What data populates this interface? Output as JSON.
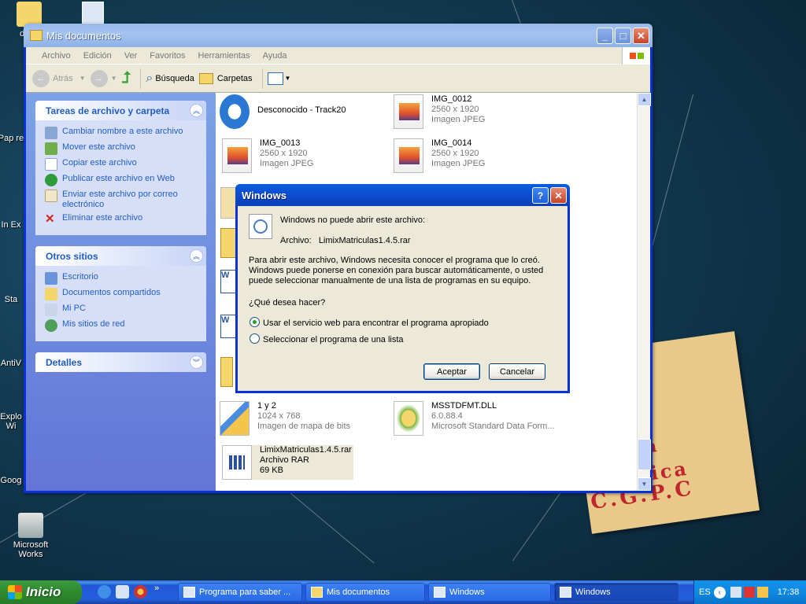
{
  "desktop": {
    "icons": [
      {
        "label": "docu"
      },
      {
        "label": "Pap re"
      },
      {
        "label": "In Ex"
      },
      {
        "label": "Sta"
      },
      {
        "label": "AntiV"
      },
      {
        "label": "Explo Wi"
      },
      {
        "label": "Goog"
      },
      {
        "label": "Microsoft Works"
      }
    ],
    "note_lines": [
      "a",
      "sica",
      "C.G.P.C"
    ]
  },
  "explorer": {
    "title": "Mis documentos",
    "menu": [
      "Archivo",
      "Edición",
      "Ver",
      "Favoritos",
      "Herramientas",
      "Ayuda"
    ],
    "toolbar": {
      "back": "Atrás",
      "search": "Búsqueda",
      "folders": "Carpetas"
    },
    "panels": {
      "tasks": {
        "title": "Tareas de archivo y carpeta",
        "items": [
          "Cambiar nombre a este archivo",
          "Mover este archivo",
          "Copiar este archivo",
          "Publicar este archivo en Web",
          "Enviar este archivo por correo electrónico",
          "Eliminar este archivo"
        ]
      },
      "other": {
        "title": "Otros sitios",
        "items": [
          "Escritorio",
          "Documentos compartidos",
          "Mi PC",
          "Mis sitios de red"
        ]
      },
      "details": {
        "title": "Detalles"
      }
    },
    "files": [
      {
        "name": "Desconocido - Track20",
        "l2": "",
        "l3": ""
      },
      {
        "name": "IMG_0012",
        "l2": "2560 x 1920",
        "l3": "Imagen JPEG"
      },
      {
        "name": "IMG_0013",
        "l2": "2560 x 1920",
        "l3": "Imagen JPEG"
      },
      {
        "name": "IMG_0014",
        "l2": "2560 x 1920",
        "l3": "Imagen JPEG"
      },
      {
        "name": "1 y 2",
        "l2": "1024 x 768",
        "l3": "Imagen de mapa de bits"
      },
      {
        "name": "MSSTDFMT.DLL",
        "l2": "6.0.88.4",
        "l3": "Microsoft Standard Data Form..."
      },
      {
        "name": "LimixMatriculas1.4.5.rar",
        "l2": "Archivo RAR",
        "l3": "69 KB"
      }
    ]
  },
  "dialog": {
    "title": "Windows",
    "help_btn": "?",
    "msg1": "Windows no puede abrir este archivo:",
    "file_label": "Archivo:",
    "file_name": "LimixMatriculas1.4.5.rar",
    "para1": "Para abrir este archivo, Windows necesita conocer el programa que lo creó.",
    "para2": "Windows puede ponerse en conexión para buscar automáticamente, o usted",
    "para3": "puede seleccionar manualmente de una lista de programas en su equipo.",
    "question": "¿Qué desea hacer?",
    "option1": "Usar el servicio web para encontrar el programa apropiado",
    "option2": "Seleccionar el programa de una lista",
    "ok": "Aceptar",
    "cancel": "Cancelar"
  },
  "taskbar": {
    "start": "Inicio",
    "buttons": [
      "Programa para saber ...",
      "Mis documentos",
      "Windows",
      "Windows"
    ],
    "lang": "ES",
    "clock": "17:38"
  }
}
